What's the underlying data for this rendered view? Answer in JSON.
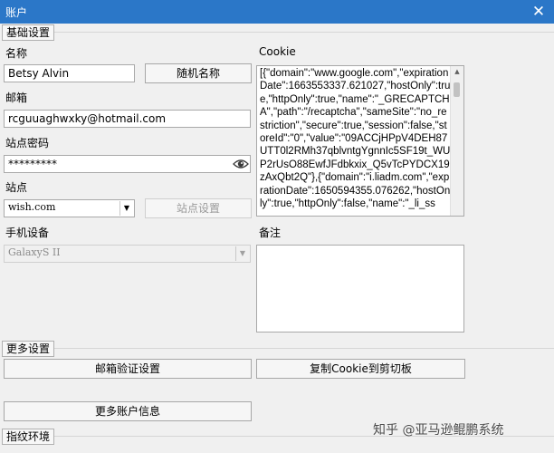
{
  "window": {
    "title": "账户",
    "close_glyph": "✕"
  },
  "basic_settings": {
    "group_label": "基础设置",
    "name_label": "名称",
    "name_value": "Betsy Alvin",
    "random_name_button": "随机名称",
    "email_label": "邮箱",
    "email_value": "rcguuaghwxky@hotmail.com",
    "site_password_label": "站点密码",
    "site_password_value": "*********",
    "site_label": "站点",
    "site_value": "wish.com",
    "site_settings_button": "站点设置",
    "device_label": "手机设备",
    "device_value": "GalaxyS II",
    "cookie_label": "Cookie",
    "cookie_value": "[{\"domain\":\"www.google.com\",\"expirationDate\":1663553337.621027,\"hostOnly\":true,\"httpOnly\":true,\"name\":\"_GRECAPTCHA\",\"path\":\"/recaptcha\",\"sameSite\":\"no_restriction\",\"secure\":true,\"session\":false,\"storeId\":\"0\",\"value\":\"09ACCjHPpV4DEH87UTT0l2RMh37qblvntgYgnnIc5SF19t_WUP2rUsO88EwfJFdbkxix_Q5vTcPYDCX19zAxQbt2Q\"},{\"domain\":\"i.liadm.com\",\"expirationDate\":1650594355.076262,\"hostOnly\":true,\"httpOnly\":false,\"name\":\"_li_ss",
    "notes_label": "备注",
    "notes_value": ""
  },
  "more_settings": {
    "group_label": "更多设置",
    "email_verify_button": "邮箱验证设置",
    "copy_cookie_button": "复制Cookie到剪切板",
    "more_account_info_button": "更多账户信息"
  },
  "fingerprint": {
    "group_label": "指纹环境"
  },
  "watermark": "知乎 @亚马逊鲲鹏系统",
  "colors": {
    "titlebar": "#2b77c8",
    "background": "#f0f0f0"
  },
  "icons": {
    "password_reveal": "eye-icon",
    "dropdown": "chevron-down-icon"
  }
}
